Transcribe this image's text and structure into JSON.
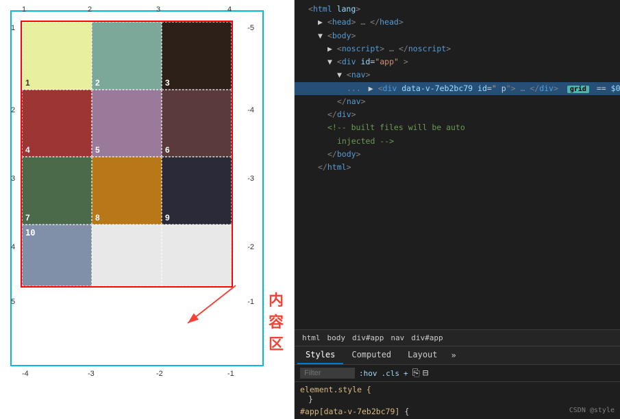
{
  "left": {
    "grid_numbers_top": [
      "1",
      "2",
      "3",
      "4"
    ],
    "grid_numbers_left": [
      "1",
      "2",
      "3",
      "4",
      "5"
    ],
    "grid_numbers_bottom": [
      "-4",
      "-3",
      "-2",
      "-1"
    ],
    "grid_numbers_right": [
      "-5",
      "-4",
      "-3",
      "-2",
      "-1"
    ],
    "cells": [
      {
        "num": "1",
        "color": "#e8f0a0"
      },
      {
        "num": "2",
        "color": "#7ba898"
      },
      {
        "num": "3",
        "color": "#2d2018"
      },
      {
        "num": "4",
        "color": "#9e3535"
      },
      {
        "num": "5",
        "color": "#9a7a9a"
      },
      {
        "num": "6",
        "color": "#5a3a3a"
      },
      {
        "num": "7",
        "color": "#4a6a4a"
      },
      {
        "num": "8",
        "color": "#b87818"
      },
      {
        "num": "9",
        "color": "#2a2a38"
      }
    ],
    "bottom_cells": [
      {
        "num": "10",
        "color": "#8090a8"
      },
      {
        "num": "",
        "color": "#e8e8e8"
      },
      {
        "num": "",
        "color": "#e8e8e8"
      }
    ],
    "content_label": "内容区",
    "annotation_label": "内容区"
  },
  "right": {
    "html_lines": [
      {
        "indent": 0,
        "content": "<html lang>"
      },
      {
        "indent": 1,
        "content": "▶ <head>…</head>"
      },
      {
        "indent": 1,
        "content": "▼ <body>"
      },
      {
        "indent": 2,
        "content": "▶ <noscript>…</noscript>"
      },
      {
        "indent": 2,
        "content": "▼ <div id=\"app\">"
      },
      {
        "indent": 3,
        "content": "▼ <nav>"
      },
      {
        "indent": 4,
        "content": "... ▶ <div data-v-7eb2bc79 id=\"...\" p\">…</div>  grid  == $0",
        "selected": true
      },
      {
        "indent": 4,
        "content": "</nav>"
      },
      {
        "indent": 3,
        "content": "</div>"
      },
      {
        "indent": 2,
        "content": "<!-- built files will be auto injected -->"
      },
      {
        "indent": 2,
        "content": "</body>"
      },
      {
        "indent": 1,
        "content": "</html>"
      }
    ],
    "breadcrumbs": [
      "html",
      "body",
      "div#app",
      "nav",
      "div#app"
    ],
    "tabs": [
      "Styles",
      "Computed",
      "Layout",
      "»"
    ],
    "active_tab": "Styles",
    "filter_placeholder": "Filter",
    "filter_hov": ":hov",
    "filter_cls": ".cls",
    "filter_plus": "+",
    "css_rules": [
      {
        "selector": "element.style {",
        "props": [],
        "close": "}"
      },
      {
        "selector": "#app[data-v-7eb2bc79] {",
        "props": [],
        "source": "CSDN @style",
        "close": ""
      }
    ]
  }
}
